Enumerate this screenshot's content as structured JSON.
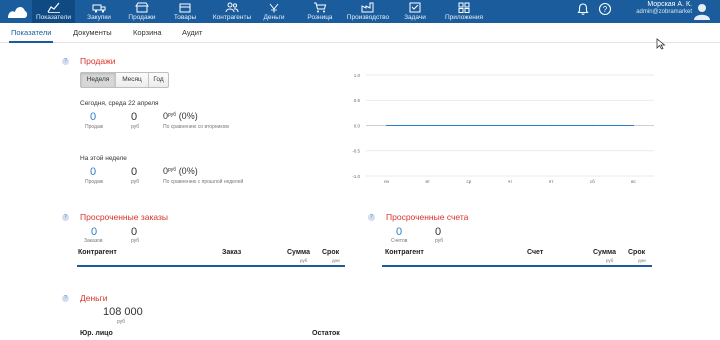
{
  "nav": {
    "items": [
      {
        "label": "Показатели",
        "icon": "chart-icon"
      },
      {
        "label": "Закупки",
        "icon": "truck-icon"
      },
      {
        "label": "Продажи",
        "icon": "store-icon"
      },
      {
        "label": "Товары",
        "icon": "box-icon"
      },
      {
        "label": "Контрагенты",
        "icon": "people-icon"
      },
      {
        "label": "Деньги",
        "icon": "money-icon"
      },
      {
        "label": "Розница",
        "icon": "cart-icon"
      },
      {
        "label": "Производство",
        "icon": "factory-icon"
      },
      {
        "label": "Задачи",
        "icon": "checklist-icon"
      },
      {
        "label": "Приложения",
        "icon": "apps-icon"
      }
    ],
    "user_name": "Морская А. К.",
    "user_email": "admin@zobramarket"
  },
  "subtabs": [
    "Показатели",
    "Документы",
    "Корзина",
    "Аудит"
  ],
  "sales": {
    "title": "Продажи",
    "periods": [
      "Неделя",
      "Месяц",
      "Год"
    ],
    "today_label": "Сегодня, среда 22 апреля",
    "week_label": "На этой неделе",
    "today": {
      "count": "0",
      "count_label": "Продаж",
      "sum": "0",
      "sum_label": "руб",
      "cmp_value": "0",
      "cmp_unit": "руб",
      "cmp_pct": "(0%)",
      "cmp_label": "По сравнению со вторником"
    },
    "week": {
      "count": "0",
      "count_label": "Продаж",
      "sum": "0",
      "sum_label": "руб",
      "cmp_value": "0",
      "cmp_unit": "руб",
      "cmp_pct": "(0%)",
      "cmp_label": "По сравнению с прошлой неделей"
    }
  },
  "chart_data": {
    "type": "line",
    "categories": [
      "пн",
      "вт",
      "ср",
      "чт",
      "пт",
      "сб",
      "вс"
    ],
    "series": [
      {
        "values": [
          0,
          0,
          0,
          0,
          0,
          0,
          0
        ]
      }
    ],
    "y_ticks": [
      "1.0",
      "0.5",
      "0.0",
      "-0.5",
      "-1.0"
    ],
    "ylim": [
      -1.0,
      1.0
    ],
    "grid": true,
    "line_color": "#2a7fc9"
  },
  "overdue_orders": {
    "title": "Просроченные заказы",
    "count": "0",
    "count_label": "Заказов",
    "sum": "0",
    "sum_label": "руб",
    "columns": [
      "Контрагент",
      "Заказ",
      "Сумма",
      "Срок"
    ],
    "sum_unit": "руб",
    "term_unit": "дни"
  },
  "overdue_invoices": {
    "title": "Просроченные счета",
    "count": "0",
    "count_label": "Счетов",
    "sum": "0",
    "sum_label": "руб",
    "columns": [
      "Контрагент",
      "Счет",
      "Сумма",
      "Срок"
    ],
    "sum_unit": "руб",
    "term_unit": "дни"
  },
  "money": {
    "title": "Деньги",
    "total": "108 000",
    "total_unit": "руб",
    "columns": [
      "Юр. лицо",
      "Остаток"
    ]
  },
  "colors": {
    "topbar": "#1b5d9c",
    "accent_red": "#d9342b",
    "accent_blue": "#2a7fc9"
  }
}
